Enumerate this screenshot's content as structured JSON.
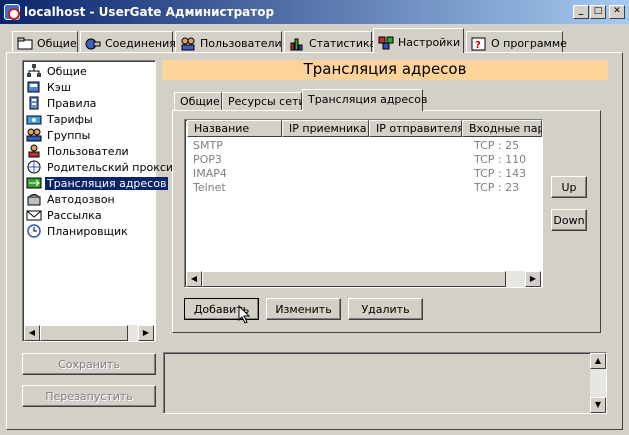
{
  "window": {
    "title": "localhost - UserGate Администратор",
    "controls": [
      "_",
      "□",
      "✕"
    ]
  },
  "tabs": [
    {
      "label": "Общие",
      "icon": "general-icon"
    },
    {
      "label": "Соединения",
      "icon": "connections-icon"
    },
    {
      "label": "Пользователи",
      "icon": "users-icon"
    },
    {
      "label": "Статистика",
      "icon": "statistics-icon"
    },
    {
      "label": "Настройки",
      "icon": "settings-icon",
      "active": true
    },
    {
      "label": "О программе",
      "icon": "help-icon"
    }
  ],
  "tree": {
    "items": [
      {
        "label": "Общие",
        "icon": "network-icon"
      },
      {
        "label": "Кэш",
        "icon": "cache-icon"
      },
      {
        "label": "Правила",
        "icon": "rules-icon"
      },
      {
        "label": "Тарифы",
        "icon": "tariffs-icon"
      },
      {
        "label": "Группы",
        "icon": "groups-icon"
      },
      {
        "label": "Пользователи",
        "icon": "users-icon"
      },
      {
        "label": "Родительский прокси",
        "icon": "parent-proxy-icon"
      },
      {
        "label": "Трансляция адресов",
        "icon": "nat-icon",
        "selected": true
      },
      {
        "label": "Автодозвон",
        "icon": "autodial-icon"
      },
      {
        "label": "Рассылка",
        "icon": "mailing-icon"
      },
      {
        "label": "Планировщик",
        "icon": "scheduler-icon"
      }
    ]
  },
  "left_buttons": {
    "save": "Сохранить",
    "restart": "Перезапустить"
  },
  "panel": {
    "title": "Трансляция адресов",
    "subtabs": [
      {
        "label": "Общие"
      },
      {
        "label": "Ресурсы сети"
      },
      {
        "label": "Трансляция адресов",
        "active": true
      }
    ],
    "columns": [
      "Название",
      "IP приемника",
      "IP отправителя",
      "Входные пар-"
    ],
    "rows": [
      {
        "name": "SMTP",
        "in": "TCP : 25"
      },
      {
        "name": "POP3",
        "in": "TCP : 110"
      },
      {
        "name": "IMAP4",
        "in": "TCP : 143"
      },
      {
        "name": "Telnet",
        "in": "TCP : 23"
      }
    ],
    "up": "Up",
    "down": "Down",
    "add": "Добавить",
    "edit": "Изменить",
    "delete": "Удалить"
  },
  "colors": {
    "title_bar": "#0a246a",
    "header_panel": "#fcd39a",
    "selection": "#0a246a",
    "face": "#d4d0c8"
  }
}
